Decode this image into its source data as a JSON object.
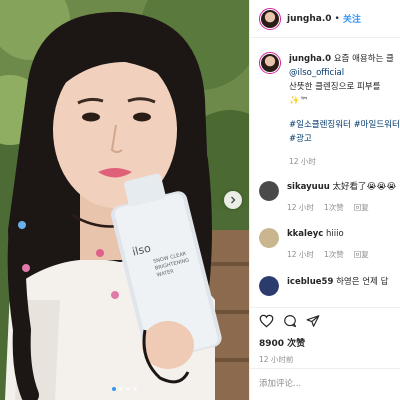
{
  "post": {
    "username": "jungha.0",
    "separator": "•",
    "follow_label": "关注"
  },
  "caption": {
    "username": "jungha.0",
    "line1": "요즘 애용하는 클",
    "mention": "@ilso_official",
    "line2": "산뜻한 클렌징으로 피부를",
    "emoji": "✨™",
    "tags": "#일소클렌징워터 #마일드워터 #광고",
    "time": "12 小时"
  },
  "replies": [
    {
      "username": "sikayuuu",
      "text": "太好看了😭😭😭",
      "time": "12 小时",
      "likes": "1次赞",
      "reply": "回复",
      "color": "#4a4a4a"
    },
    {
      "username": "kkaleyc",
      "text": "hiiio",
      "time": "12 小时",
      "likes": "1次赞",
      "reply": "回复",
      "color": "#c9b58e"
    },
    {
      "username": "iceblue59",
      "text": "하영은 언제 답",
      "color": "#2b3b6e"
    }
  ],
  "stats": {
    "likes": "8900 次赞",
    "date": "12 小时前"
  },
  "comment_box": {
    "placeholder": "添加评论..."
  },
  "media": {
    "bottle_brand": "ilso",
    "bottle_text_1": "SNOW CLEAR",
    "bottle_text_2": "BRIGHTENING",
    "bottle_text_3": "WATER"
  },
  "colors": {
    "link": "#00376b",
    "accent": "#3897f0",
    "ring": "#d6249f"
  }
}
